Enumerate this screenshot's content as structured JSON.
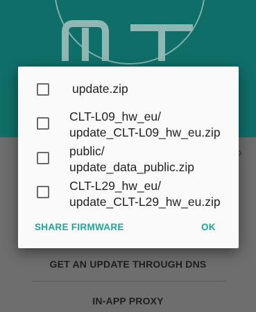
{
  "background": {
    "logo_text": "MT",
    "menu_items": [
      {
        "label": "GET AN UPDATE THROUGH DNS"
      },
      {
        "label": "IN-APP PROXY"
      }
    ]
  },
  "dialog": {
    "options": [
      {
        "line1": "update.zip",
        "line2": "",
        "checked": false
      },
      {
        "line1": "CLT-L09_hw_eu/",
        "line2": "update_CLT-L09_hw_eu.zip",
        "checked": false
      },
      {
        "line1": "public/",
        "line2": "update_data_public.zip",
        "checked": false
      },
      {
        "line1": "CLT-L29_hw_eu/",
        "line2": "update_CLT-L29_hw_eu.zip",
        "checked": false
      }
    ],
    "share_button": "SHARE FIRMWARE",
    "ok_button": "OK"
  },
  "colors": {
    "accent": "#1aa69e",
    "header": "#106e69",
    "scrim": "#6e6e6e"
  }
}
